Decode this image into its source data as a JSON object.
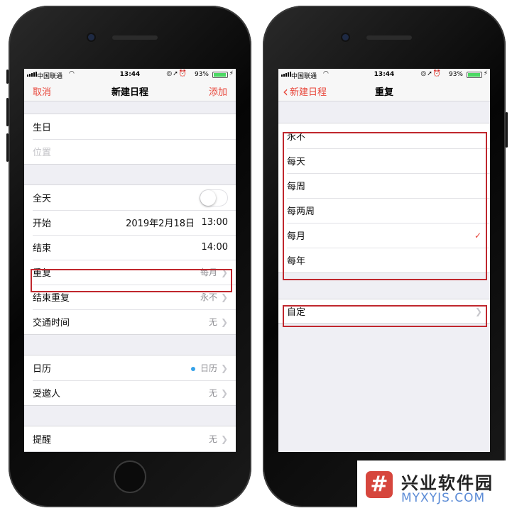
{
  "status_bar": {
    "carrier": "中国联通",
    "time": "13:44",
    "battery_pct": "93%",
    "battery_level": 0.93
  },
  "left_screen": {
    "nav": {
      "cancel": "取消",
      "title": "新建日程",
      "add": "添加"
    },
    "group1": {
      "title_value": "生日",
      "location_placeholder": "位置"
    },
    "group2": {
      "all_day": "全天",
      "all_day_on": false,
      "start_label": "开始",
      "start_date": "2019年2月18日",
      "start_time": "13:00",
      "end_label": "结束",
      "end_time": "14:00",
      "repeat_label": "重复",
      "repeat_value": "每月",
      "end_repeat_label": "结束重复",
      "end_repeat_value": "永不",
      "travel_label": "交通时间",
      "travel_value": "无"
    },
    "group3": {
      "calendar_label": "日历",
      "calendar_value": "日历",
      "calendar_color": "#35a1e8",
      "invitees_label": "受邀人",
      "invitees_value": "无"
    },
    "group4": {
      "alert_label": "提醒",
      "alert_value": "无"
    }
  },
  "right_screen": {
    "nav": {
      "back": "新建日程",
      "title": "重复"
    },
    "options": [
      "永不",
      "每天",
      "每周",
      "每两周",
      "每月",
      "每年"
    ],
    "selected_index": 4,
    "custom": "自定"
  },
  "watermark": {
    "logo_char": "#",
    "name": "兴业软件园",
    "url": "MYXYJS.COM"
  },
  "colors": {
    "accent": "#e8463a",
    "highlight": "#c0272d"
  }
}
